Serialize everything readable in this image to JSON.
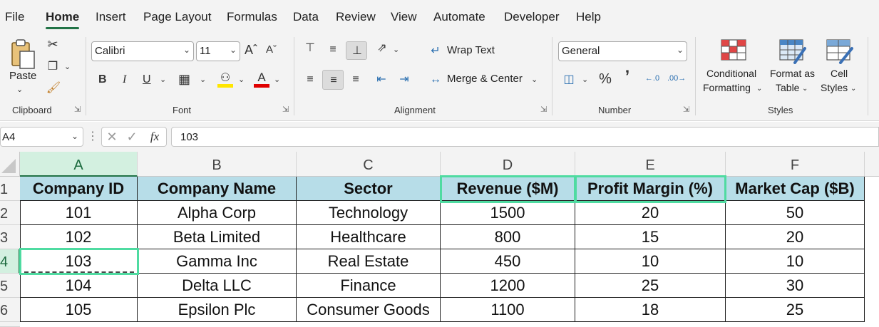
{
  "menu": {
    "tabs": [
      "File",
      "Home",
      "Insert",
      "Page Layout",
      "Formulas",
      "Data",
      "Review",
      "View",
      "Automate",
      "Developer",
      "Help"
    ],
    "active": "Home"
  },
  "ribbon": {
    "clipboard": {
      "paste": "Paste",
      "label": "Clipboard"
    },
    "font": {
      "name": "Calibri",
      "size": "11",
      "bold": "B",
      "italic": "I",
      "underline": "U",
      "label": "Font"
    },
    "alignment": {
      "wrap_text": "Wrap Text",
      "merge_center": "Merge & Center",
      "label": "Alignment"
    },
    "number": {
      "format": "General",
      "percent": "%",
      "comma": "’",
      "label": "Number"
    },
    "styles": {
      "conditional_1": "Conditional",
      "conditional_2": "Formatting",
      "format_table_1": "Format as",
      "format_table_2": "Table",
      "cell_styles_1": "Cell",
      "cell_styles_2": "Styles",
      "label": "Styles"
    }
  },
  "formula_bar": {
    "name_box": "A4",
    "fx": "fx",
    "value": "103"
  },
  "grid": {
    "columns": [
      "A",
      "B",
      "C",
      "D",
      "E",
      "F"
    ],
    "rows": [
      "1",
      "2",
      "3",
      "4",
      "5",
      "6"
    ],
    "headers": [
      "Company ID",
      "Company Name",
      "Sector",
      "Revenue ($M)",
      "Profit Margin (%)",
      "Market Cap ($B)"
    ],
    "data": [
      [
        "101",
        "Alpha Corp",
        "Technology",
        "1500",
        "20",
        "50"
      ],
      [
        "102",
        "Beta Limited",
        "Healthcare",
        "800",
        "15",
        "20"
      ],
      [
        "103",
        "Gamma Inc",
        "Real Estate",
        "450",
        "10",
        "10"
      ],
      [
        "104",
        "Delta LLC",
        "Finance",
        "1200",
        "25",
        "30"
      ],
      [
        "105",
        "Epsilon Plc",
        "Consumer Goods",
        "1100",
        "18",
        "25"
      ]
    ],
    "selected_cell": "A4",
    "highlight_color": "#4fdba1",
    "header_fill": "#b7dde8"
  }
}
